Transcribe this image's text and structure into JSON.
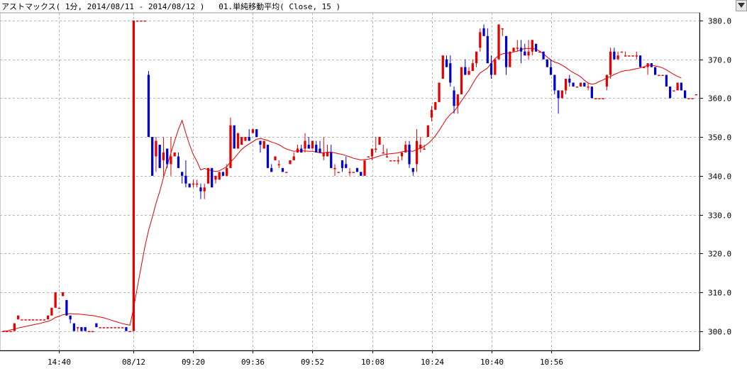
{
  "header": {
    "title": "アストマックス( 1分, 2014/08/11 - 2014/08/12 )   01.単純移動平均( Close, 15 )"
  },
  "controls": {
    "dropdown_icon": "triangle-down-icon"
  },
  "colors": {
    "up": "#e60000",
    "down": "#0000cc",
    "ma": "#e00000",
    "grid": "#b4b4b4",
    "axis": "#000000"
  },
  "chart_data": {
    "type": "candlestick",
    "title": "アストマックス( 1分, 2014/08/11 - 2014/08/12 )",
    "indicator": "01.単純移動平均( Close, 15 )",
    "ylim": [
      295,
      382
    ],
    "yticks": [
      300,
      310,
      320,
      330,
      340,
      350,
      360,
      370,
      380
    ],
    "ytick_labels": [
      "300.0",
      "310.0",
      "320.0",
      "330.0",
      "340.0",
      "350.0",
      "360.0",
      "370.0",
      "380.0"
    ],
    "xticks": [
      {
        "label": "14:40",
        "index": 15
      },
      {
        "label": "08/12",
        "index": 35
      },
      {
        "label": "09:20",
        "index": 51
      },
      {
        "label": "09:36",
        "index": 67
      },
      {
        "label": "09:52",
        "index": 83
      },
      {
        "label": "10:08",
        "index": 99
      },
      {
        "label": "10:24",
        "index": 115
      },
      {
        "label": "10:40",
        "index": 131
      },
      {
        "label": "10:56",
        "index": 147
      }
    ],
    "candles": [
      [
        300,
        300,
        300,
        300
      ],
      [
        300,
        300,
        300,
        300
      ],
      [
        300,
        300,
        300,
        300
      ],
      [
        300,
        302,
        300,
        302
      ],
      [
        303,
        304,
        303,
        304
      ],
      [
        303,
        303,
        303,
        303
      ],
      [
        303,
        303,
        303,
        303
      ],
      [
        303,
        303,
        303,
        303
      ],
      [
        303,
        303,
        303,
        303
      ],
      [
        303,
        303,
        303,
        303
      ],
      [
        303,
        303,
        303,
        303
      ],
      [
        303,
        303,
        303,
        303
      ],
      [
        303,
        304,
        303,
        304
      ],
      [
        304,
        306,
        304,
        306
      ],
      [
        306,
        310,
        306,
        310
      ],
      [
        306,
        306,
        306,
        306
      ],
      [
        309,
        310,
        309,
        310
      ],
      [
        308,
        308,
        304,
        304
      ],
      [
        304,
        304,
        302,
        303
      ],
      [
        302,
        302,
        300,
        300
      ],
      [
        301,
        301,
        300,
        301
      ],
      [
        301,
        301,
        300,
        300
      ],
      [
        301,
        301,
        300,
        300
      ],
      [
        300,
        300,
        300,
        300
      ],
      [
        300,
        300,
        300,
        300
      ],
      [
        302,
        302,
        301,
        301
      ],
      [
        301,
        301,
        301,
        301
      ],
      [
        301,
        301,
        301,
        301
      ],
      [
        301,
        301,
        301,
        301
      ],
      [
        301,
        301,
        301,
        301
      ],
      [
        301,
        301,
        301,
        301
      ],
      [
        301,
        301,
        301,
        301
      ],
      [
        301,
        301,
        301,
        301
      ],
      [
        301,
        301,
        300,
        300
      ],
      [
        300,
        300,
        300,
        300
      ],
      [
        300,
        380,
        300,
        380
      ],
      [
        380,
        380,
        380,
        380
      ],
      [
        380,
        380,
        380,
        380
      ],
      [
        380,
        380,
        380,
        380
      ],
      [
        366,
        367,
        350,
        350
      ],
      [
        350,
        350,
        340,
        340
      ],
      [
        345,
        350,
        341,
        349
      ],
      [
        348,
        348,
        342,
        342
      ],
      [
        344,
        350,
        340,
        346
      ],
      [
        347,
        347,
        342,
        343
      ],
      [
        343,
        350,
        340,
        345
      ],
      [
        345,
        346,
        345,
        346
      ],
      [
        345,
        346,
        342,
        342
      ],
      [
        341,
        341,
        338,
        340
      ],
      [
        340,
        344,
        337,
        338
      ],
      [
        338,
        338,
        337,
        337
      ],
      [
        338,
        339,
        337,
        338
      ],
      [
        338,
        339,
        337,
        338
      ],
      [
        337,
        338,
        334,
        336
      ],
      [
        336,
        338,
        334,
        337
      ],
      [
        338,
        342,
        338,
        342
      ],
      [
        342,
        342,
        337,
        337
      ],
      [
        339,
        340,
        338,
        340
      ],
      [
        339,
        341,
        339,
        341
      ],
      [
        341,
        341,
        340,
        340
      ],
      [
        340,
        343,
        340,
        342
      ],
      [
        342,
        355,
        342,
        353
      ],
      [
        353,
        353,
        347,
        347
      ],
      [
        347,
        351,
        347,
        351
      ],
      [
        348,
        350,
        348,
        350
      ],
      [
        349,
        350,
        349,
        350
      ],
      [
        350,
        352,
        349,
        349
      ],
      [
        351,
        352,
        351,
        352
      ],
      [
        352,
        352,
        350,
        350
      ],
      [
        349,
        349,
        346,
        348
      ],
      [
        347,
        349,
        347,
        349
      ],
      [
        348,
        348,
        342,
        342
      ],
      [
        342,
        343,
        341,
        341
      ],
      [
        344,
        345,
        344,
        345
      ],
      [
        343,
        344,
        342,
        343
      ],
      [
        342,
        342,
        341,
        341
      ],
      [
        341,
        341,
        341,
        341
      ],
      [
        343,
        344,
        343,
        344
      ],
      [
        344,
        346,
        344,
        345
      ],
      [
        346,
        348,
        346,
        347
      ],
      [
        347,
        348,
        346,
        346
      ],
      [
        347,
        351,
        346,
        349
      ],
      [
        348,
        350,
        347,
        347
      ],
      [
        347,
        349,
        347,
        349
      ],
      [
        348,
        349,
        346,
        346
      ],
      [
        347,
        349,
        346,
        346
      ],
      [
        345,
        350,
        344,
        346
      ],
      [
        345,
        348,
        345,
        346
      ],
      [
        346,
        348,
        342,
        342
      ],
      [
        342,
        343,
        340,
        342
      ],
      [
        341,
        341,
        341,
        341
      ],
      [
        344,
        344,
        341,
        342
      ],
      [
        343,
        345,
        342,
        342
      ],
      [
        341,
        342,
        340,
        341
      ],
      [
        341,
        341,
        341,
        341
      ],
      [
        342,
        342,
        341,
        341
      ],
      [
        341,
        341,
        340,
        340
      ],
      [
        340,
        344,
        340,
        344
      ],
      [
        345,
        345,
        345,
        345
      ],
      [
        345,
        347,
        344,
        347
      ],
      [
        347,
        350,
        346,
        347
      ],
      [
        348,
        350,
        348,
        350
      ],
      [
        346,
        348,
        346,
        346
      ],
      [
        345,
        347,
        345,
        345
      ],
      [
        344,
        344,
        344,
        344
      ],
      [
        344,
        344,
        344,
        344
      ],
      [
        344,
        345,
        343,
        344
      ],
      [
        345,
        346,
        344,
        346
      ],
      [
        346,
        349,
        346,
        348
      ],
      [
        348,
        349,
        342,
        343
      ],
      [
        342,
        342,
        340,
        341
      ],
      [
        343,
        352,
        341,
        349
      ],
      [
        347,
        350,
        346,
        348
      ],
      [
        347,
        348,
        347,
        347
      ],
      [
        350,
        353,
        350,
        353
      ],
      [
        355,
        358,
        354,
        357
      ],
      [
        357,
        359,
        357,
        359
      ],
      [
        359,
        364,
        359,
        364
      ],
      [
        365,
        371,
        365,
        371
      ],
      [
        370,
        371,
        368,
        368
      ],
      [
        369,
        371,
        363,
        364
      ],
      [
        362,
        363,
        356,
        358
      ],
      [
        358,
        361,
        356,
        361
      ],
      [
        361,
        368,
        361,
        368
      ],
      [
        368,
        370,
        366,
        366
      ],
      [
        366,
        368,
        366,
        367
      ],
      [
        367,
        370,
        367,
        369
      ],
      [
        369,
        372,
        368,
        372
      ],
      [
        373,
        378,
        372,
        377
      ],
      [
        378,
        379,
        376,
        376
      ],
      [
        376,
        378,
        369,
        369
      ],
      [
        369,
        371,
        365,
        366
      ],
      [
        366,
        370,
        366,
        370
      ],
      [
        370,
        379,
        370,
        379
      ],
      [
        378,
        378,
        376,
        378
      ],
      [
        376,
        376,
        366,
        368
      ],
      [
        368,
        372,
        368,
        372
      ],
      [
        372,
        373,
        372,
        373
      ],
      [
        373,
        375,
        372,
        373
      ],
      [
        373,
        375,
        369,
        372
      ],
      [
        372,
        374,
        371,
        371
      ],
      [
        371,
        375,
        370,
        372
      ],
      [
        372,
        375,
        371,
        375
      ],
      [
        374,
        374,
        372,
        372
      ],
      [
        372,
        372,
        372,
        372
      ],
      [
        372,
        372,
        370,
        370
      ],
      [
        370,
        370,
        368,
        368
      ],
      [
        368,
        370,
        366,
        366
      ],
      [
        366,
        366,
        361,
        362
      ],
      [
        362,
        362,
        356,
        360
      ],
      [
        360,
        362,
        360,
        362
      ],
      [
        362,
        365,
        361,
        365
      ],
      [
        365,
        366,
        363,
        364
      ],
      [
        364,
        364,
        363,
        363
      ],
      [
        363,
        363,
        363,
        363
      ],
      [
        363,
        364,
        363,
        364
      ],
      [
        364,
        364,
        363,
        363
      ],
      [
        363,
        364,
        362,
        363
      ],
      [
        363,
        363,
        360,
        360
      ],
      [
        360,
        360,
        360,
        360
      ],
      [
        360,
        360,
        360,
        360
      ],
      [
        360,
        360,
        360,
        360
      ],
      [
        363,
        366,
        362,
        366
      ],
      [
        366,
        373,
        365,
        372
      ],
      [
        372,
        373,
        370,
        370
      ],
      [
        370,
        372,
        370,
        371
      ],
      [
        372,
        372,
        372,
        372
      ],
      [
        371,
        372,
        371,
        371
      ],
      [
        371,
        371,
        371,
        371
      ],
      [
        371,
        371,
        371,
        371
      ],
      [
        371,
        372,
        370,
        371
      ],
      [
        371,
        371,
        368,
        368
      ],
      [
        368,
        368,
        368,
        368
      ],
      [
        368,
        369,
        366,
        369
      ],
      [
        369,
        369,
        368,
        368
      ],
      [
        368,
        368,
        366,
        366
      ],
      [
        366,
        366,
        366,
        366
      ],
      [
        366,
        366,
        366,
        366
      ],
      [
        366,
        366,
        363,
        363
      ],
      [
        363,
        363,
        360,
        360
      ],
      [
        362,
        362,
        362,
        362
      ],
      [
        362,
        364,
        362,
        364
      ],
      [
        364,
        364,
        362,
        362
      ],
      [
        362,
        362,
        360,
        360
      ],
      [
        360,
        360,
        360,
        360
      ],
      [
        360,
        360,
        360,
        360
      ],
      [
        361,
        361,
        361,
        361
      ]
    ],
    "ma": [
      300,
      300,
      300.3,
      300.5,
      300.8,
      301,
      301.2,
      301.4,
      301.6,
      301.8,
      302,
      302.3,
      302.5,
      302.9,
      303.5,
      303.8,
      304.2,
      304.4,
      304.5,
      304.4,
      304.4,
      304.3,
      304.2,
      304.1,
      304,
      303.8,
      303.6,
      303.4,
      303.1,
      302.8,
      302.5,
      302.2,
      301.9,
      301.7,
      301.5,
      306,
      311.3,
      316.5,
      321.7,
      325.9,
      329.3,
      332.9,
      336,
      339.5,
      342.7,
      345.8,
      349,
      351.9,
      354.3,
      351,
      348,
      345.5,
      343.7,
      341.5,
      341.9,
      341.6,
      341.3,
      341.1,
      341.3,
      341.8,
      342.4,
      343.6,
      344.5,
      345.7,
      346.8,
      347.6,
      348.2,
      348.8,
      349.4,
      349.6,
      349.4,
      349.1,
      348.7,
      348.4,
      348,
      347.4,
      346.9,
      346.6,
      346.3,
      346.4,
      346.4,
      346.4,
      346.3,
      346.3,
      346.1,
      345.9,
      345.9,
      346.1,
      346.1,
      345.9,
      345.7,
      345.5,
      345.2,
      344.9,
      344.5,
      344.3,
      344.1,
      344.2,
      344.3,
      344.5,
      344.8,
      345.1,
      345.4,
      345.6,
      345.7,
      345.8,
      345.9,
      346.2,
      346.3,
      346.4,
      346.3,
      346.8,
      347.1,
      347.6,
      348.3,
      349.2,
      350.3,
      351.7,
      353.2,
      354.7,
      355.8,
      356.6,
      357.9,
      359.3,
      360.7,
      362,
      363.7,
      365.3,
      366.5,
      367.1,
      367.8,
      369,
      370.2,
      371,
      371.4,
      371.6,
      371.6,
      371.9,
      372.1,
      372.5,
      372.8,
      372.8,
      372.8,
      372.6,
      372.1,
      371.4,
      370.6,
      369.8,
      369.3,
      369,
      368.5,
      367.9,
      367.2,
      366.6,
      366.1,
      365.5,
      364.6,
      363.9,
      363.6,
      363.8,
      364.3,
      364.7,
      365.2,
      365.6,
      366.1,
      366.5,
      366.9,
      367.1,
      367.2,
      367.4,
      367.6,
      367.8,
      368.1,
      368.5,
      368.5,
      368.3,
      368.1,
      367.8,
      367.3,
      366.7,
      366.1,
      365.6,
      365.2
    ]
  }
}
